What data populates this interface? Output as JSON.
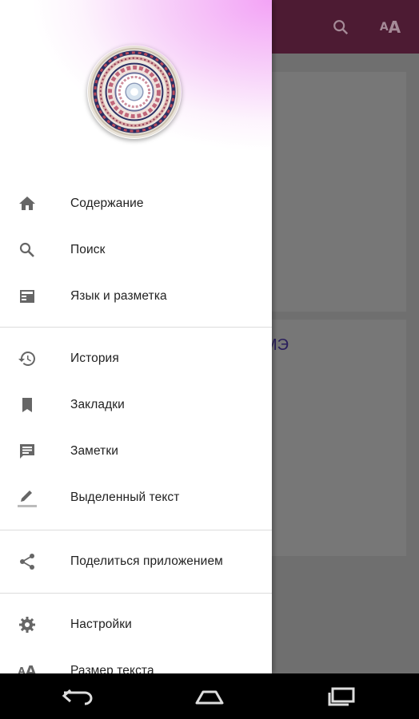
{
  "app_bar": {
    "search_icon": "search-icon",
    "text_size_icon": "text-size-icon",
    "text_size_glyph": "AA"
  },
  "background": {
    "card_text": "МЭ"
  },
  "drawer": {
    "header": {
      "logo": "mandala-logo"
    },
    "menu": [
      {
        "label": "Содержание",
        "icon": "home-icon"
      },
      {
        "label": "Поиск",
        "icon": "search-icon"
      },
      {
        "label": "Язык и разметка",
        "icon": "layout-icon"
      },
      {
        "label": "История",
        "icon": "history-icon"
      },
      {
        "label": "Закладки",
        "icon": "bookmark-icon"
      },
      {
        "label": "Заметки",
        "icon": "note-icon"
      },
      {
        "label": "Выделенный текст",
        "icon": "highlight-pen-icon"
      },
      {
        "label": "Поделиться приложением",
        "icon": "share-icon"
      },
      {
        "label": "Настройки",
        "icon": "gear-icon"
      },
      {
        "label": "Размер текста",
        "icon": "text-size-icon"
      }
    ]
  },
  "navbar": {
    "back": "back-icon",
    "home": "home-nav-icon",
    "recents": "recents-icon"
  },
  "colors": {
    "app_bar": "#4d1b33",
    "scrim": "#6f6f6f",
    "icon_gray": "#666666",
    "header_pink": "#f3a3f6"
  }
}
